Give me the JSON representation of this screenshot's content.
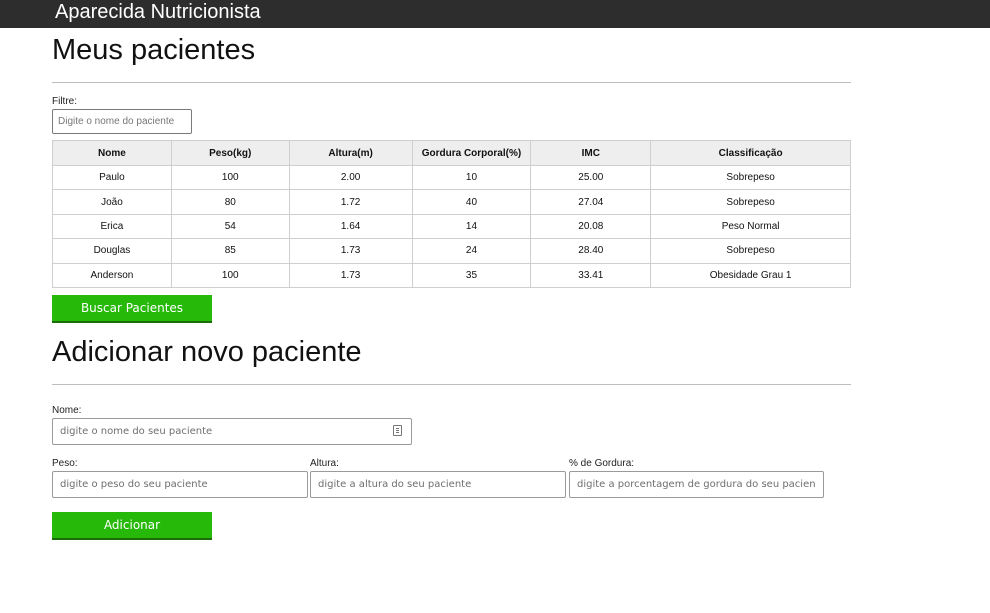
{
  "header": {
    "brand": "Aparecida Nutricionista"
  },
  "patients_section": {
    "title": "Meus pacientes",
    "filter_label": "Filtre:",
    "filter_placeholder": "Digite o nome do paciente",
    "columns": [
      "Nome",
      "Peso(kg)",
      "Altura(m)",
      "Gordura Corporal(%)",
      "IMC",
      "Classificação"
    ],
    "rows": [
      [
        "Paulo",
        "100",
        "2.00",
        "10",
        "25.00",
        "Sobrepeso"
      ],
      [
        "João",
        "80",
        "1.72",
        "40",
        "27.04",
        "Sobrepeso"
      ],
      [
        "Erica",
        "54",
        "1.64",
        "14",
        "20.08",
        "Peso Normal"
      ],
      [
        "Douglas",
        "85",
        "1.73",
        "24",
        "28.40",
        "Sobrepeso"
      ],
      [
        "Anderson",
        "100",
        "1.73",
        "35",
        "33.41",
        "Obesidade Grau 1"
      ]
    ],
    "search_button": "Buscar Pacientes"
  },
  "add_section": {
    "title": "Adicionar novo paciente",
    "name_label": "Nome:",
    "name_placeholder": "digite o nome do seu paciente",
    "weight_label": "Peso:",
    "weight_placeholder": "digite o peso do seu paciente",
    "height_label": "Altura:",
    "height_placeholder": "digite a altura do seu paciente",
    "fat_label": "% de Gordura:",
    "fat_placeholder": "digite a porcentagem de gordura do seu paciente",
    "add_button": "Adicionar"
  },
  "colors": {
    "header_bg": "#2d2d2d",
    "button_bg": "#27b90a",
    "table_header_bg": "#eeeeee"
  }
}
